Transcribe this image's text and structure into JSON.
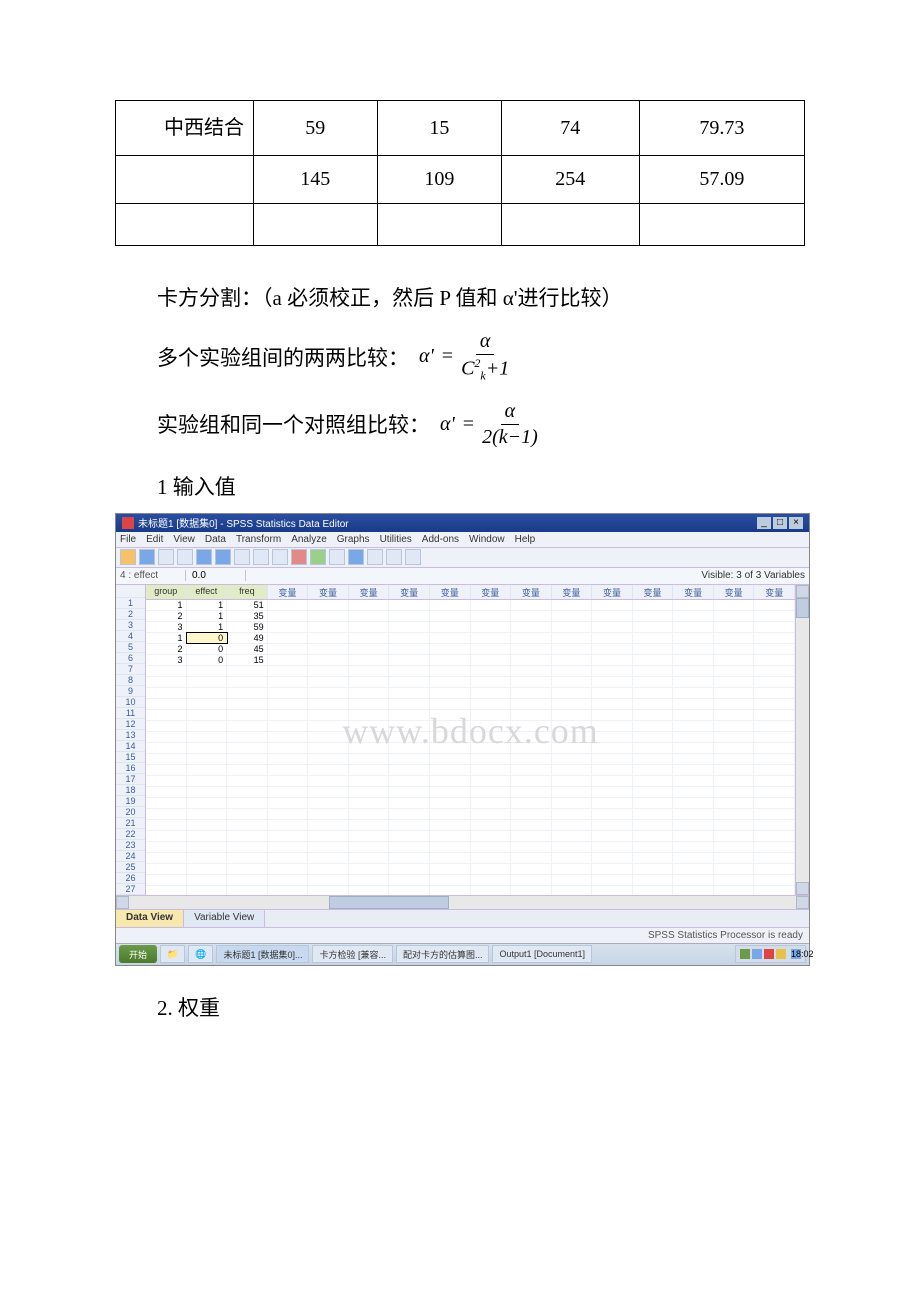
{
  "table": {
    "rows": [
      {
        "label": "　　中西结合",
        "c1": "59",
        "c2": "15",
        "c3": "74",
        "c4": "79.73"
      },
      {
        "label": "",
        "c1": "145",
        "c2": "109",
        "c3": "254",
        "c4": "57.09"
      },
      {
        "label": "",
        "c1": "",
        "c2": "",
        "c3": "",
        "c4": ""
      }
    ]
  },
  "text": {
    "p1": "卡方分割：（a 必须校正，然后 P 值和 α'进行比较）",
    "p2_label": "多个实验组间的两两比较：",
    "p3_label": "实验组和同一个对照组比较：",
    "p4": "1 输入值",
    "p5": "2. 权重"
  },
  "formula1": {
    "lhs": "α'",
    "num": "α",
    "den_left": "C",
    "den_sup": "2",
    "den_sub": "k",
    "den_plus": "+1"
  },
  "formula2": {
    "lhs": "α'",
    "num": "α",
    "den": "2(k−1)"
  },
  "screenshot": {
    "title": "未标题1 [数据集0] - SPSS Statistics Data Editor",
    "menu": [
      "File",
      "Edit",
      "View",
      "Data",
      "Transform",
      "Analyze",
      "Graphs",
      "Utilities",
      "Add-ons",
      "Window",
      "Help"
    ],
    "editlabel": "4 : effect",
    "editval": "0.0",
    "visible": "Visible: 3 of 3 Variables",
    "cols_named": [
      "group",
      "effect",
      "freq"
    ],
    "col_var": "变量",
    "data": [
      [
        "1",
        "1",
        "51"
      ],
      [
        "2",
        "1",
        "35"
      ],
      [
        "3",
        "1",
        "59"
      ],
      [
        "1",
        "0",
        "49"
      ],
      [
        "2",
        "0",
        "45"
      ],
      [
        "3",
        "0",
        "15"
      ]
    ],
    "rowcount": 27,
    "watermark": "www.bdocx.com",
    "tabs": {
      "data": "Data View",
      "var": "Variable View"
    },
    "status": "SPSS Statistics Processor is ready",
    "taskbar": {
      "start": "开始",
      "items": [
        "未标题1 [数据集0]...",
        "卡方检验 [兼容...",
        "配对卡方的估算图...",
        "Output1 [Document1]"
      ],
      "clock": "18:02"
    }
  }
}
